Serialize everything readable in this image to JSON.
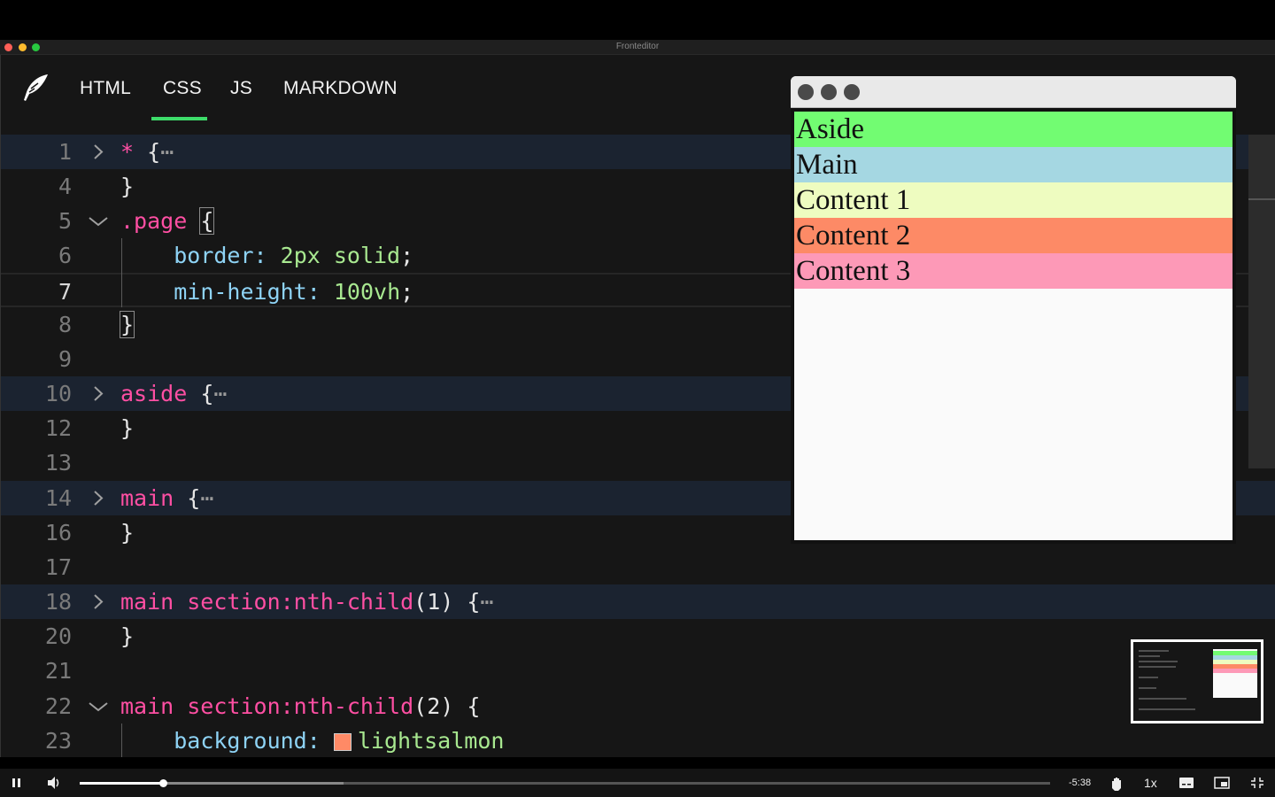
{
  "window": {
    "title": "Fronteditor"
  },
  "tabs": [
    {
      "label": "HTML"
    },
    {
      "label": "CSS",
      "active": true
    },
    {
      "label": "JS"
    },
    {
      "label": "MARKDOWN"
    }
  ],
  "code": {
    "lines": [
      {
        "num": "1",
        "fold": "collapsed"
      },
      {
        "num": "4"
      },
      {
        "num": "5",
        "fold": "expanded"
      },
      {
        "num": "6"
      },
      {
        "num": "7",
        "current": true
      },
      {
        "num": "8"
      },
      {
        "num": "9"
      },
      {
        "num": "10",
        "fold": "collapsed"
      },
      {
        "num": "12"
      },
      {
        "num": "13"
      },
      {
        "num": "14",
        "fold": "collapsed"
      },
      {
        "num": "16"
      },
      {
        "num": "17"
      },
      {
        "num": "18",
        "fold": "collapsed"
      },
      {
        "num": "20"
      },
      {
        "num": "21"
      },
      {
        "num": "22",
        "fold": "expanded"
      },
      {
        "num": "23"
      }
    ],
    "tokens": {
      "star": "*",
      "open_brace": "{",
      "close_brace": "}",
      "ellipsis": "⋯",
      "page_selector": ".page",
      "border_prop": "border:",
      "border_val": "2px solid",
      "minh_prop": "min-height:",
      "minh_val": "100vh",
      "semicolon": ";",
      "aside_selector": "aside",
      "main_selector": "main",
      "main_nth1_selector": "main section:nth-child",
      "nth1_arg": "(1)",
      "nth2_arg": "(2)",
      "bg_prop": "background:",
      "bg_val": "lightsalmon"
    }
  },
  "preview": {
    "blocks": [
      {
        "label": "Aside",
        "color": "#72fc72"
      },
      {
        "label": "Main",
        "color": "#a5d7e2"
      },
      {
        "label": "Content 1",
        "color": "#eefcc0"
      },
      {
        "label": "Content 2",
        "color": "#fd8a66"
      },
      {
        "label": "Content 3",
        "color": "#fd99b7"
      }
    ]
  },
  "player": {
    "time_remaining": "-5:38",
    "speed": "1x",
    "progress": 0.086,
    "buffered": 0.272
  },
  "colors": {
    "accent": "#3ddc6a",
    "selector": "#ff4fa3",
    "property": "#8ed3f5",
    "value": "#a8e890"
  }
}
